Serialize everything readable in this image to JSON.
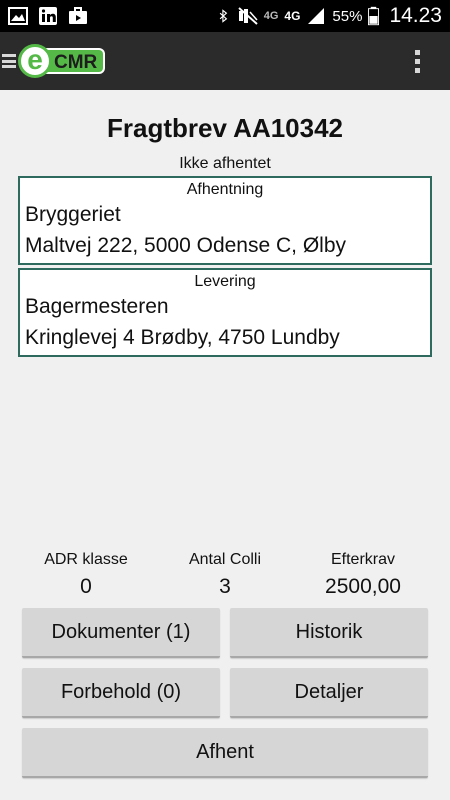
{
  "statusbar": {
    "net_4g_dim": "4G",
    "net_4g": "4G",
    "battery_pct": "55%",
    "time": "14.23"
  },
  "app": {
    "logo_e": "e",
    "logo_cmr": "CMR"
  },
  "waybill": {
    "title": "Fragtbrev AA10342",
    "status": "Ikke afhentet"
  },
  "pickup": {
    "header": "Afhentning",
    "name": "Bryggeriet",
    "address": "Maltvej 222, 5000 Odense C, Ølby"
  },
  "delivery": {
    "header": "Levering",
    "name": "Bagermesteren",
    "address": "Kringlevej 4 Brødby, 4750 Lundby"
  },
  "stats": {
    "adr_label": "ADR klasse",
    "adr_value": "0",
    "colli_label": "Antal Colli",
    "colli_value": "3",
    "efterkrav_label": "Efterkrav",
    "efterkrav_value": "2500,00"
  },
  "buttons": {
    "dokumenter": "Dokumenter (1)",
    "historik": "Historik",
    "forbehold": "Forbehold (0)",
    "detaljer": "Detaljer",
    "afhent": "Afhent"
  },
  "colors": {
    "border_accent": "#2e6b5e",
    "logo_green": "#55b947"
  }
}
